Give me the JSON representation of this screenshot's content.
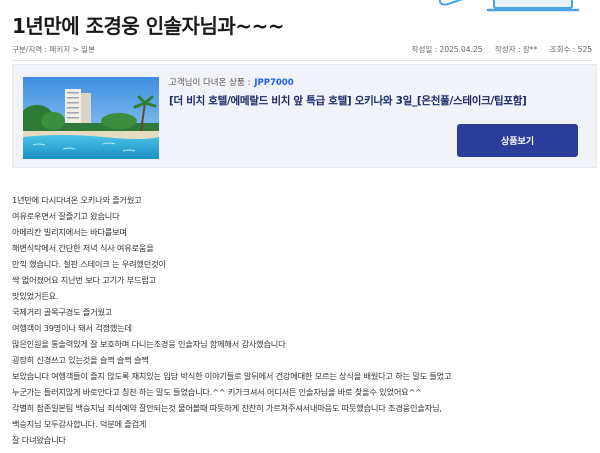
{
  "post": {
    "title": "1년만에 조경웅 인솔자님과~~~",
    "category": "구분/지역 : 패키지 > 일본",
    "date": "작성일 : 2025.04.25",
    "author": "작성자 : 장**",
    "views": "조회수 : 525"
  },
  "product": {
    "subtitle_prefix": "고객님이 다녀온 상품 :",
    "code": "JPP7000",
    "name": "[더 비치 호텔/에메랄드 비치 앞 특급 호텔] 오키나와 3일_[온천풀/스테이크/팁포함]",
    "button_label": "상품보기"
  },
  "content": {
    "lines": [
      "1년만에 다시다녀온 오키나와  즐거웠고",
      "여유로우면서 잘즐기고 왔습니다",
      "아메리칸 빌리지에서는 바다를보며",
      "해변식탁에서 간단한 저녁 식사 여유로움을",
      "만끽 했습니다. 철판 스테이크 는 우려했던것이",
      "싹 없어졌어요  지난번 보다 고기가 부드럽고",
      "맛있었거든요.",
      "국제거리 골목구경도 즐거웠고",
      "여행객이 39명이나 돼서 걱정했는데",
      " 많은인원을  통솔력있게 잘 보호하며  다니는조경웅 인솔자님 함께해서 감사했습니다",
      "굉장히 신경쓰고 있는것을 슬쩍 슬쩍 슬쩍",
      "보았습니다  여행객들이 즐지 않도록 재치있는 입담 박식한 이야기들로 알뒤에서 건강에대한 모르는 상식을 배웠다고 하는 말도 들었고",
      "누군가는 들러지않게 바로안다고 칭찬 하는 말도 들었습니다.^^   키가크셔서 어디서든 인솔자님을 바로 찾을수 있었어요^^",
      "각별히 참존일본팀  백승지님 죄석예약  잘안되는것 물어볼때  따듯하게 찬찬히  가르쳐주셔서내마음도 따듯했습니다    조경웅인솔자님,",
      "백승지님 모두감사합니다. 덕분에  즐겁게",
      "잘 다녀왔습니다"
    ]
  },
  "colors": {
    "accent_blue": "#1f5ee8",
    "button_bg": "#2a3d9b",
    "card_bg": "#f1f3f8",
    "product_name": "#1b2a6b"
  },
  "icons": {
    "header_decoration": "laptop-illustration-icon"
  }
}
